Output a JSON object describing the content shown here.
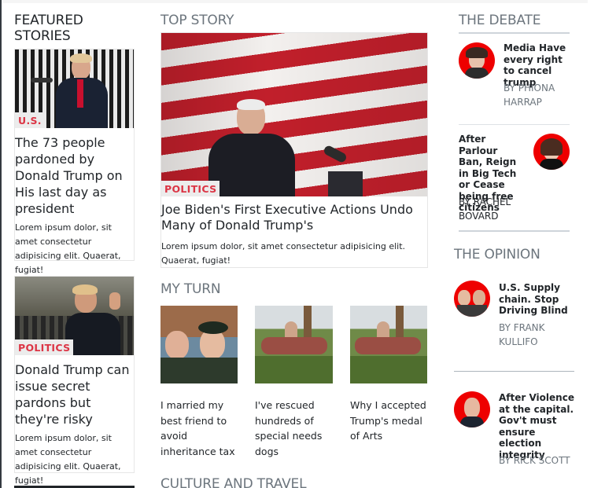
{
  "featured": {
    "heading": "FEATURED STORIES",
    "stories": [
      {
        "category": "U.S.",
        "title": "The 73 people pardoned by Donald Trump on His last day as president",
        "text": "Lorem ipsum dolor, sit amet consectetur adipisicing elit. Quaerat, fugiat!"
      },
      {
        "category": "POLITICS",
        "title": "Donald Trump can issue secret pardons but they're risky",
        "text": "Lorem ipsum dolor, sit amet consectetur adipisicing elit. Quaerat, fugiat!"
      }
    ]
  },
  "top_story": {
    "heading": "TOP STORY",
    "category": "POLITICS",
    "title": "Joe Biden's First Executive Actions Undo Many of Donald Trump's",
    "text": "Lorem ipsum dolor, sit amet consectetur adipisicing elit. Quaerat, fugiat!"
  },
  "my_turn": {
    "heading": "MY TURN",
    "items": [
      {
        "text": "I married my best friend to avoid inheritance tax"
      },
      {
        "text": "I've rescued hundreds of special needs dogs"
      },
      {
        "text": "Why I accepted Trump's medal of Arts"
      }
    ]
  },
  "culture": {
    "heading": "CULTURE AND TRAVEL"
  },
  "debate": {
    "heading": "THE DEBATE",
    "items": [
      {
        "title": "Media Have every right to cancel trump",
        "byline": "BY PHIONA HARRAP"
      },
      {
        "title": "After Parlour Ban, Reign in Big Tech or Cease being free citizens",
        "byline": "BY RACHEL BOVARD"
      }
    ]
  },
  "opinion": {
    "heading": "THE OPINION",
    "items": [
      {
        "title": "U.S. Supply chain. Stop Driving Blind",
        "byline": "BY FRANK KULLIFO"
      },
      {
        "title": "After Violence at the capital. Gov't must ensure election integrity",
        "byline": "BY RICK SCOTT"
      }
    ]
  },
  "colors": {
    "accent": "#dc3545",
    "muted": "#6c757d",
    "avatar_bg": "#e60000"
  }
}
